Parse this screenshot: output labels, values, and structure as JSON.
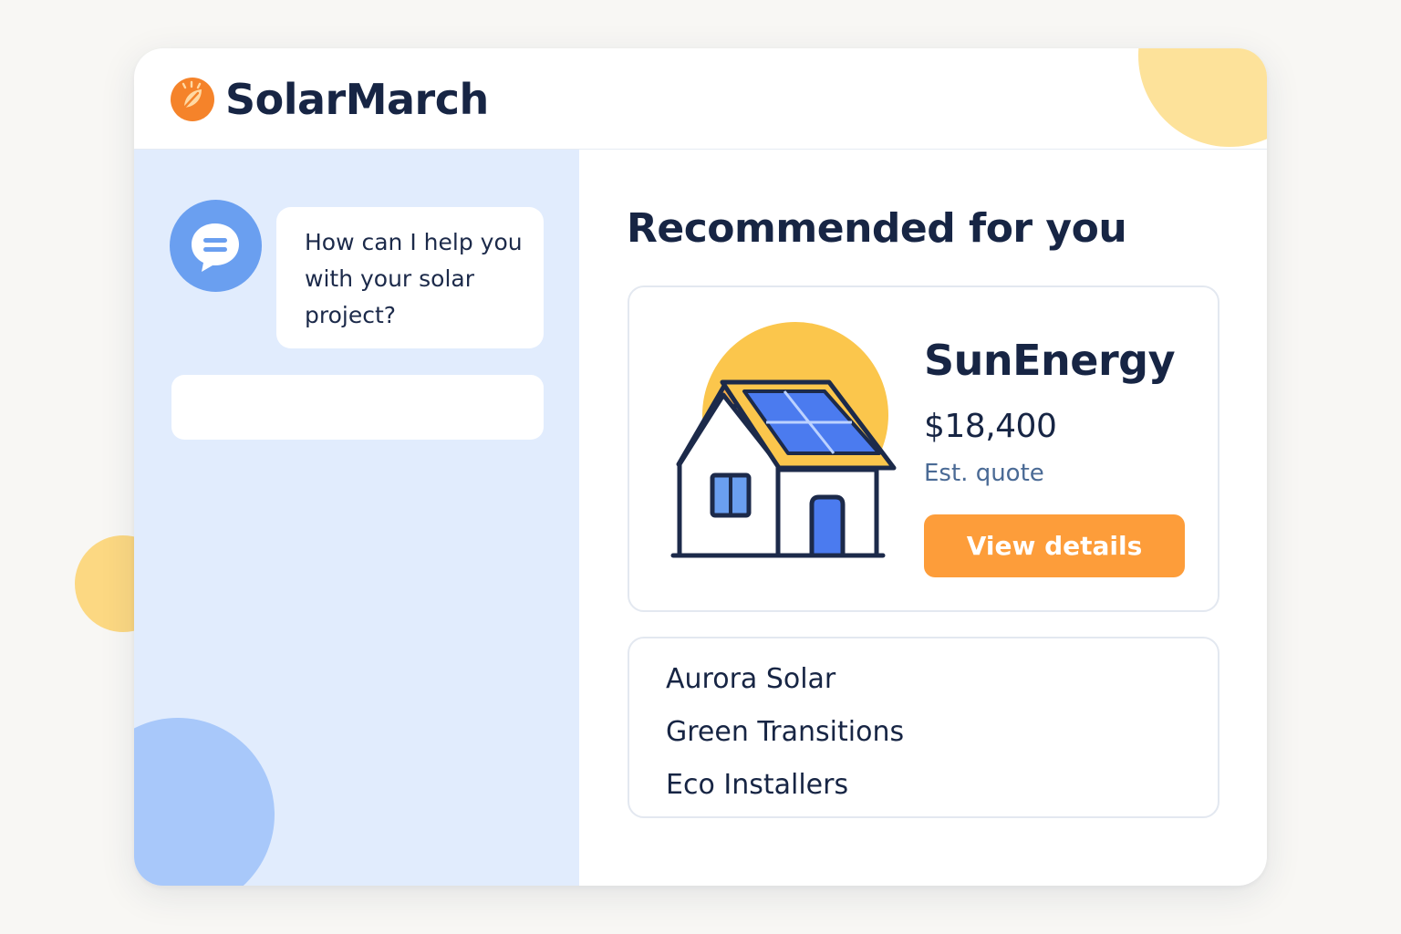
{
  "brand": {
    "name": "SolarMarch",
    "logo_icon": "sun-leaf-icon",
    "accent_color": "#fd9d3a",
    "primary_text_color": "#172544"
  },
  "chat": {
    "avatar_icon": "chat-bubble-icon",
    "message": "How can I help you with your solar project?",
    "input_placeholder": ""
  },
  "recommendations": {
    "title": "Recommended for you",
    "featured": {
      "illustration": "solar-house-illustration",
      "name": "SunEnergy",
      "price": "$18,400",
      "price_label": "Est. quote",
      "cta_label": "View details"
    },
    "others": [
      {
        "name": "Aurora Solar"
      },
      {
        "name": "Green Transitions"
      },
      {
        "name": "Eco Installers"
      }
    ]
  }
}
